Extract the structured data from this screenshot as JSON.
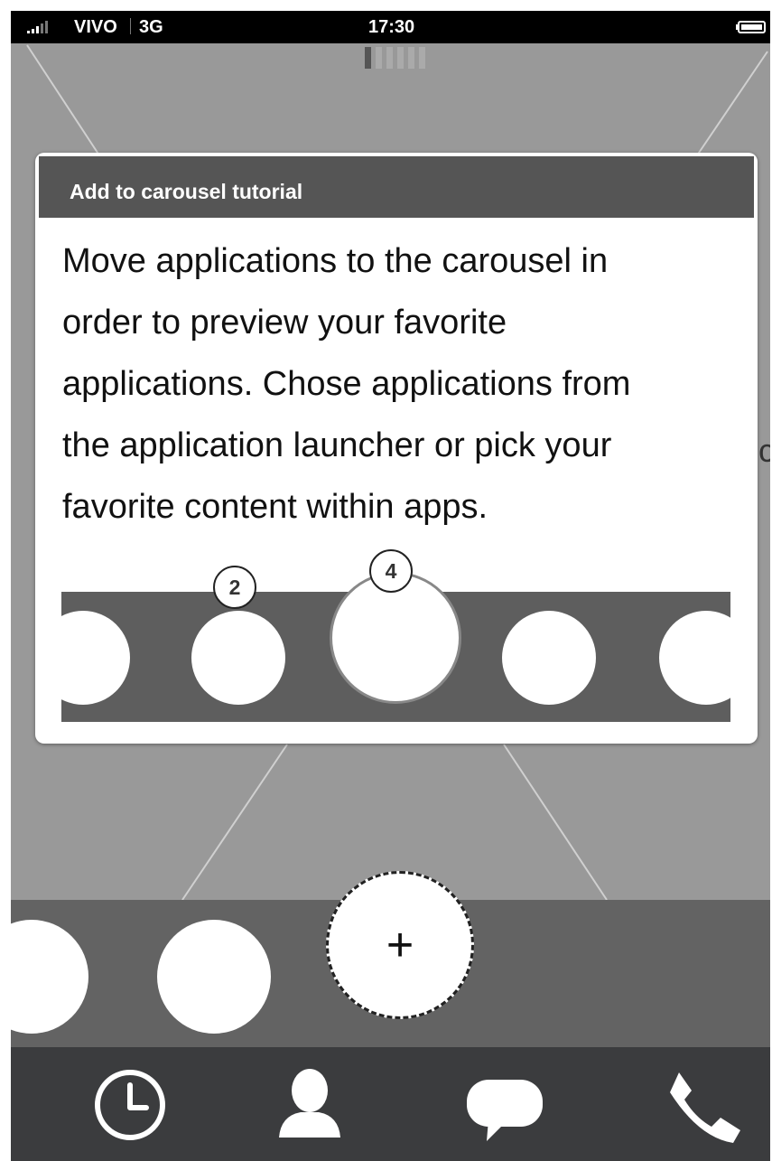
{
  "status_bar": {
    "carrier": "VIVO",
    "network": "3G",
    "time": "17:30"
  },
  "background_peek_text": "c",
  "dialog": {
    "title": "Add to carousel tutorial",
    "body_lines": [
      "Move applications to the carousel in",
      "order to preview your favorite",
      "applications. Chose applications from",
      "the application launcher or pick your",
      "favorite content within apps."
    ],
    "badges": [
      "2",
      "4"
    ]
  },
  "carousel": {
    "add_label": "+"
  },
  "dock": {
    "items": [
      "clock-icon",
      "contact-icon",
      "message-icon",
      "phone-icon"
    ]
  },
  "colors": {
    "dark": "#3b3c3e",
    "strip": "#5e5e5e",
    "background": "#999999"
  }
}
